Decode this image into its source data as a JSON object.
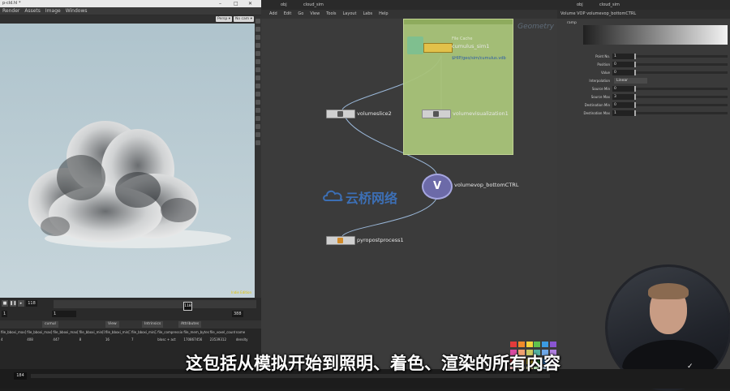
{
  "viewer": {
    "window_title": "p-cld.hl *",
    "menu": [
      "Render",
      "Assets",
      "Image",
      "Windows"
    ],
    "viewport_buttons": [
      "Persp ▾",
      "No cam ▾"
    ],
    "corner_label": "Indie Edition"
  },
  "timeline": {
    "frame": "118",
    "marker": "118",
    "range_start": "1",
    "range_start2": "1",
    "range_end": "388",
    "range_end2": "388",
    "ticks": [
      "1",
      "24",
      "48",
      "72",
      "96",
      "120",
      "144",
      "168",
      "192",
      "216",
      "240",
      "264",
      "288",
      "312",
      "336",
      "360",
      "384"
    ]
  },
  "spreadsheet": {
    "node": "cumul",
    "view": "View",
    "attrib": "Intrinsics",
    "attr2": "Attributes",
    "headers": [
      "file_bboxi_max[0]",
      "file_bboxi_max[1]",
      "file_bboxi_max[2]",
      "file_bboxi_min[0]",
      "file_bboxi_min[1]",
      "file_bboxi_min[2]",
      "file_compressio",
      "file_mem_bytes",
      "file_voxel_count",
      "name"
    ],
    "row": [
      "4",
      "408",
      "447",
      "8",
      "16",
      "7",
      "blosc + act",
      "170867456",
      "23539312",
      "density"
    ]
  },
  "bottom_timeline": {
    "frame": "184"
  },
  "network": {
    "tabs": [
      "obj",
      "cloud_sim"
    ],
    "menu": [
      "Add",
      "Edit",
      "Go",
      "View",
      "Tools",
      "Layout",
      "Labs",
      "Help"
    ],
    "context_label": "Geometry",
    "nodes": {
      "file_cache_type": "File Cache",
      "file_cache_name": "cumulus_sim1",
      "file_cache_sub": "$HIP/geo/sim/cumulus.vdb",
      "volumeslice": "volumeslice2",
      "volumevis": "volumevisualization1",
      "volumevop": "volumevop_bottomCTRL",
      "pyropost": "pyropostprocess1"
    },
    "vop_letter": "V",
    "watermark": "云桥网络",
    "swatch_colors": [
      "#e23b3b",
      "#ef8a2a",
      "#f2d23a",
      "#5fc24c",
      "#3b9be2",
      "#8a55d2",
      "#d94aa0",
      "#f0a070",
      "#c8c860",
      "#50b0a0",
      "#6fa8e8",
      "#b080e0",
      "#a02828",
      "#c87020",
      "#b8a020",
      "#3a8a3a",
      "#2a6ab0",
      "#6a3aa0",
      "#f4c4c4",
      "#f4dcb0",
      "#f4f0b0",
      "#c8f0c0",
      "#c0dcf4",
      "#dcc8f4"
    ]
  },
  "params": {
    "tabs": [
      "obj",
      "cloud_sim"
    ],
    "header_type": "Volume VOP",
    "header_name": "volumevop_bottomCTRL",
    "ramp_label": "ramp",
    "rows": [
      {
        "label": "Point No.",
        "value": "1"
      },
      {
        "label": "Position",
        "value": "0"
      },
      {
        "label": "Value",
        "value": "0"
      },
      {
        "label": "Interpolation",
        "value": "Linear"
      },
      {
        "label": "Source Min",
        "value": "0"
      },
      {
        "label": "Source Max",
        "value": "3"
      },
      {
        "label": "Destination Min",
        "value": "0"
      },
      {
        "label": "Destination Max",
        "value": "1"
      }
    ]
  },
  "subtitle": "这包括从模拟开始到照明、着色、渲染的所有内容",
  "webcam": {
    "shirt_logo": "✓"
  }
}
